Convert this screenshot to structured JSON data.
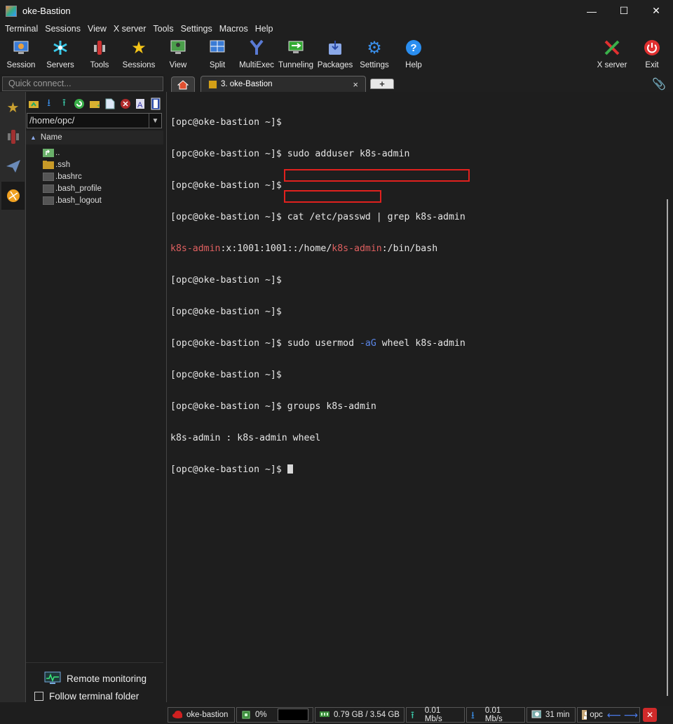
{
  "window": {
    "title": "oke-Bastion",
    "minimize": "—",
    "maximize": "☐",
    "close": "✕"
  },
  "menu": [
    "Terminal",
    "Sessions",
    "View",
    "X server",
    "Tools",
    "Settings",
    "Macros",
    "Help"
  ],
  "toolbar": {
    "session": "Session",
    "servers": "Servers",
    "tools": "Tools",
    "sessions": "Sessions",
    "view": "View",
    "split": "Split",
    "multiexec": "MultiExec",
    "tunneling": "Tunneling",
    "packages": "Packages",
    "settings": "Settings",
    "help": "Help",
    "xserver": "X server",
    "exit": "Exit"
  },
  "quick_connect": {
    "placeholder": "Quick connect..."
  },
  "tabs": {
    "active_label": "3. oke-Bastion",
    "close": "×",
    "add": "+"
  },
  "sftp": {
    "path": "/home/opc/",
    "column_name": "Name",
    "files": [
      "..",
      ".ssh",
      ".bashrc",
      ".bash_profile",
      ".bash_logout"
    ],
    "remote_monitoring": "Remote monitoring",
    "follow_folder": "Follow terminal folder"
  },
  "terminal": {
    "prompt": "[opc@oke-bastion ~]$",
    "cmd_adduser": " sudo adduser k8s-admin",
    "cmd_cat": " cat /etc/passwd | grep k8s-admin",
    "passwd_user": "k8s-admin",
    "passwd_mid": ":x:1001:1001::/home/",
    "passwd_user2": "k8s-admin",
    "passwd_tail": ":/bin/bash",
    "cmd_usermod_a": "sudo usermod ",
    "cmd_usermod_flag": "-aG",
    "cmd_usermod_b": " wheel k8s-admin",
    "cmd_groups": "groups k8s-admin",
    "groups_out": "k8s-admin : k8s-admin wheel"
  },
  "status": {
    "host": "oke-bastion",
    "cpu": "0%",
    "memory": "0.79 GB / 3.54 GB",
    "upload": "0.01 Mb/s",
    "download": "0.01 Mb/s",
    "uptime": "31 min",
    "user": "opc"
  },
  "colors": {
    "highlight": "#e0211e",
    "filename": "#e06060",
    "flag": "#5a86e8",
    "background": "#1e1e1e"
  }
}
